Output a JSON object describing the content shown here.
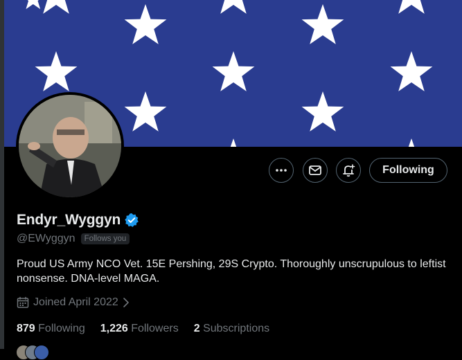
{
  "profile": {
    "display_name": "Endyr_Wyggyn",
    "handle": "@EWyggyn",
    "follows_you": "Follows you",
    "bio": "Proud US Army NCO Vet. 15E Pershing, 29S Crypto.  Thoroughly unscrupulous to leftist nonsense.  DNA-level MAGA.",
    "joined": "Joined April 2022"
  },
  "actions": {
    "following_label": "Following"
  },
  "stats": [
    {
      "count": "879",
      "label": "Following"
    },
    {
      "count": "1,226",
      "label": "Followers"
    },
    {
      "count": "2",
      "label": "Subscriptions"
    }
  ],
  "colors": {
    "banner_blue": "#2a3c90",
    "verified_blue": "#1d9bf0",
    "muted_text": "#71767b"
  },
  "icons": [
    "more-icon",
    "message-icon",
    "notification-bell-icon",
    "verified-badge-icon",
    "calendar-icon",
    "chevron-right-icon"
  ]
}
